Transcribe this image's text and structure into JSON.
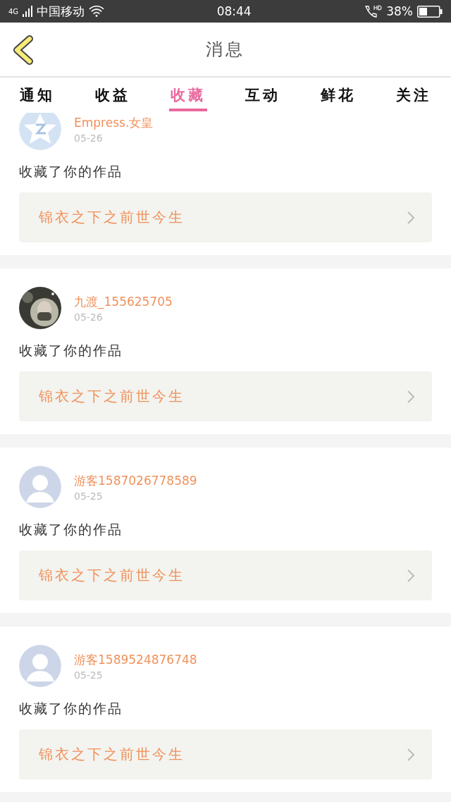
{
  "status_bar": {
    "network": "4G",
    "carrier": "中国移动",
    "time": "08:44",
    "battery": "38%"
  },
  "header": {
    "title": "消息"
  },
  "tabs": [
    {
      "label": "通知",
      "selected": false
    },
    {
      "label": "收益",
      "selected": false
    },
    {
      "label": "收藏",
      "selected": true
    },
    {
      "label": "互动",
      "selected": false
    },
    {
      "label": "鲜花",
      "selected": false
    },
    {
      "label": "关注",
      "selected": false
    }
  ],
  "messages": [
    {
      "avatar": {
        "kind": "logo"
      },
      "name": "Empress.女皇",
      "date": "05-26",
      "text": "收藏了你的作品",
      "work": "锦衣之下之前世今生"
    },
    {
      "name": "九渡_155625705",
      "date": "05-26",
      "text": "收藏了你的作品",
      "work": "锦衣之下之前世今生"
    },
    {
      "avatar": {
        "kind": "default"
      },
      "name": "游客1587026778589",
      "date": "05-25",
      "text": "收藏了你的作品",
      "work": "锦衣之下之前世今生"
    },
    {
      "avatar": {
        "kind": "default"
      },
      "name": "游客1589524876748",
      "date": "05-25",
      "text": "收藏了你的作品",
      "work": "锦衣之下之前世今生"
    }
  ]
}
